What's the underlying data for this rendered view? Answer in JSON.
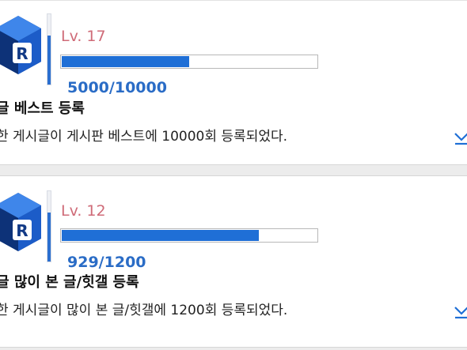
{
  "colors": {
    "level_text": "#cf6b78",
    "progress_fill": "#1f6fd6",
    "progress_text": "#2a6cc6",
    "badge_dark": "#0f3a8a",
    "badge_mid": "#1c5cc8",
    "badge_light": "#3f86ea"
  },
  "achievements": [
    {
      "level": "Lv. 17",
      "progress_current": "5000",
      "progress_separator": "/",
      "progress_total": "10000",
      "progress_fraction": 0.5,
      "title": "글 베스트 등록",
      "description": "한 게시글이 게시판 베스트에 10000회 등록되었다.",
      "badge_icon": "r-cube-badge-icon",
      "expand_icon": "chevron-down-icon"
    },
    {
      "level": "Lv. 12",
      "progress_current": "929",
      "progress_separator": "/",
      "progress_total": "1200",
      "progress_fraction": 0.774,
      "title": "글 많이 본 글/힛갤 등록",
      "description": "한 게시글이 많이 본 글/힛갤에 1200회 등록되었다.",
      "badge_icon": "r-cube-badge-icon",
      "expand_icon": "chevron-down-icon"
    }
  ]
}
